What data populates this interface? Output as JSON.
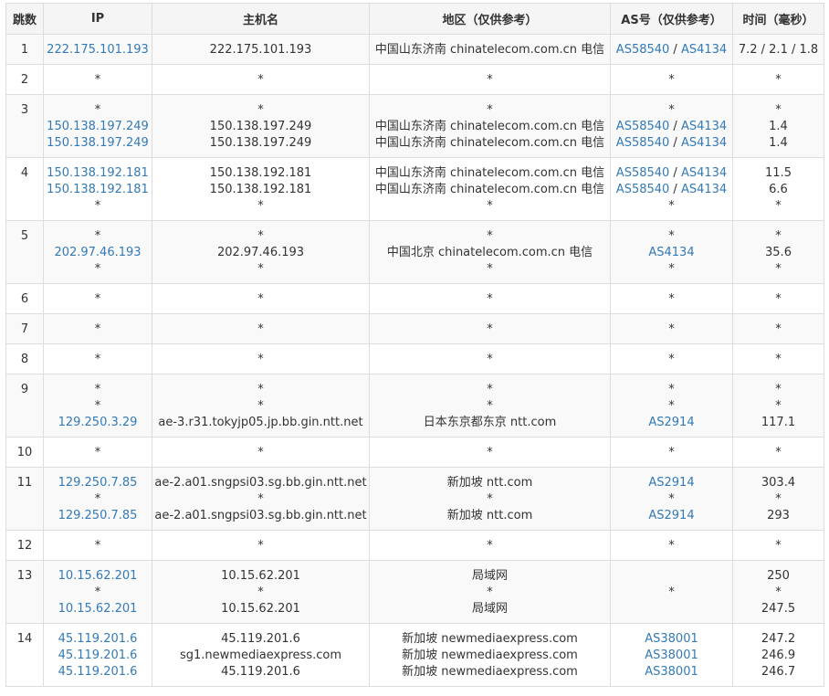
{
  "headers": {
    "hop": "跳数",
    "ip": "IP",
    "host": "主机名",
    "region": "地区（仅供参考）",
    "as": "AS号（仅供参考）",
    "time": "时间（毫秒）"
  },
  "rows": [
    {
      "hop": "1",
      "ip": [
        "222.175.101.193"
      ],
      "host": [
        "222.175.101.193"
      ],
      "region": [
        "中国山东济南 chinatelecom.com.cn 电信"
      ],
      "as": [
        [
          "AS58540",
          "AS4134"
        ]
      ],
      "time": [
        "7.2 / 2.1 / 1.8"
      ]
    },
    {
      "hop": "2",
      "ip": [
        "*"
      ],
      "host": [
        "*"
      ],
      "region": [
        "*"
      ],
      "as": [
        [
          "*"
        ]
      ],
      "time": [
        "*"
      ]
    },
    {
      "hop": "3",
      "ip": [
        "*",
        "150.138.197.249",
        "150.138.197.249"
      ],
      "host": [
        "*",
        "150.138.197.249",
        "150.138.197.249"
      ],
      "region": [
        "*",
        "中国山东济南 chinatelecom.com.cn 电信",
        "中国山东济南 chinatelecom.com.cn 电信"
      ],
      "as": [
        [
          "*"
        ],
        [
          "AS58540",
          "AS4134"
        ],
        [
          "AS58540",
          "AS4134"
        ]
      ],
      "time": [
        "*",
        "1.4",
        "1.4"
      ]
    },
    {
      "hop": "4",
      "ip": [
        "150.138.192.181",
        "150.138.192.181",
        "*"
      ],
      "host": [
        "150.138.192.181",
        "150.138.192.181",
        "*"
      ],
      "region": [
        "中国山东济南 chinatelecom.com.cn 电信",
        "中国山东济南 chinatelecom.com.cn 电信",
        "*"
      ],
      "as": [
        [
          "AS58540",
          "AS4134"
        ],
        [
          "AS58540",
          "AS4134"
        ],
        [
          "*"
        ]
      ],
      "time": [
        "11.5",
        "6.6",
        "*"
      ]
    },
    {
      "hop": "5",
      "ip": [
        "*",
        "202.97.46.193",
        "*"
      ],
      "host": [
        "*",
        "202.97.46.193",
        "*"
      ],
      "region": [
        "*",
        "中国北京 chinatelecom.com.cn 电信",
        "*"
      ],
      "as": [
        [
          "*"
        ],
        [
          "AS4134"
        ],
        [
          "*"
        ]
      ],
      "time": [
        "*",
        "35.6",
        "*"
      ]
    },
    {
      "hop": "6",
      "ip": [
        "*"
      ],
      "host": [
        "*"
      ],
      "region": [
        "*"
      ],
      "as": [
        [
          "*"
        ]
      ],
      "time": [
        "*"
      ]
    },
    {
      "hop": "7",
      "ip": [
        "*"
      ],
      "host": [
        "*"
      ],
      "region": [
        "*"
      ],
      "as": [
        [
          "*"
        ]
      ],
      "time": [
        "*"
      ]
    },
    {
      "hop": "8",
      "ip": [
        "*"
      ],
      "host": [
        "*"
      ],
      "region": [
        "*"
      ],
      "as": [
        [
          "*"
        ]
      ],
      "time": [
        "*"
      ]
    },
    {
      "hop": "9",
      "ip": [
        "*",
        "*",
        "129.250.3.29"
      ],
      "host": [
        "*",
        "*",
        "ae-3.r31.tokyjp05.jp.bb.gin.ntt.net"
      ],
      "region": [
        "*",
        "*",
        "日本东京都东京 ntt.com"
      ],
      "as": [
        [
          "*"
        ],
        [
          "*"
        ],
        [
          "AS2914"
        ]
      ],
      "time": [
        "*",
        "*",
        "117.1"
      ]
    },
    {
      "hop": "10",
      "ip": [
        "*"
      ],
      "host": [
        "*"
      ],
      "region": [
        "*"
      ],
      "as": [
        [
          "*"
        ]
      ],
      "time": [
        "*"
      ]
    },
    {
      "hop": "11",
      "ip": [
        "129.250.7.85",
        "*",
        "129.250.7.85"
      ],
      "host": [
        "ae-2.a01.sngpsi03.sg.bb.gin.ntt.net",
        "*",
        "ae-2.a01.sngpsi03.sg.bb.gin.ntt.net"
      ],
      "region": [
        "新加坡 ntt.com",
        "*",
        "新加坡 ntt.com"
      ],
      "as": [
        [
          "AS2914"
        ],
        [
          "*"
        ],
        [
          "AS2914"
        ]
      ],
      "time": [
        "303.4",
        "*",
        "293"
      ]
    },
    {
      "hop": "12",
      "ip": [
        "*"
      ],
      "host": [
        "*"
      ],
      "region": [
        "*"
      ],
      "as": [
        [
          "*"
        ]
      ],
      "time": [
        "*"
      ]
    },
    {
      "hop": "13",
      "ip": [
        "10.15.62.201",
        "*",
        "10.15.62.201"
      ],
      "host": [
        "10.15.62.201",
        "*",
        "10.15.62.201"
      ],
      "region": [
        "局域网",
        "*",
        "局域网"
      ],
      "as": [
        [
          ""
        ],
        [
          "*"
        ],
        [
          ""
        ]
      ],
      "time": [
        "250",
        "*",
        "247.5"
      ]
    },
    {
      "hop": "14",
      "ip": [
        "45.119.201.6",
        "45.119.201.6",
        "45.119.201.6"
      ],
      "host": [
        "45.119.201.6",
        "sg1.newmediaexpress.com",
        "45.119.201.6"
      ],
      "region": [
        "新加坡 newmediaexpress.com",
        "新加坡 newmediaexpress.com",
        "新加坡 newmediaexpress.com"
      ],
      "as": [
        [
          "AS38001"
        ],
        [
          "AS38001"
        ],
        [
          "AS38001"
        ]
      ],
      "time": [
        "247.2",
        "246.9",
        "246.7"
      ]
    }
  ],
  "colors": {
    "link": "#337ab7",
    "text": "#333333",
    "border": "#dddddd",
    "header_bg": "#f5f5f5",
    "stripe_bg": "#f9f9f9"
  }
}
